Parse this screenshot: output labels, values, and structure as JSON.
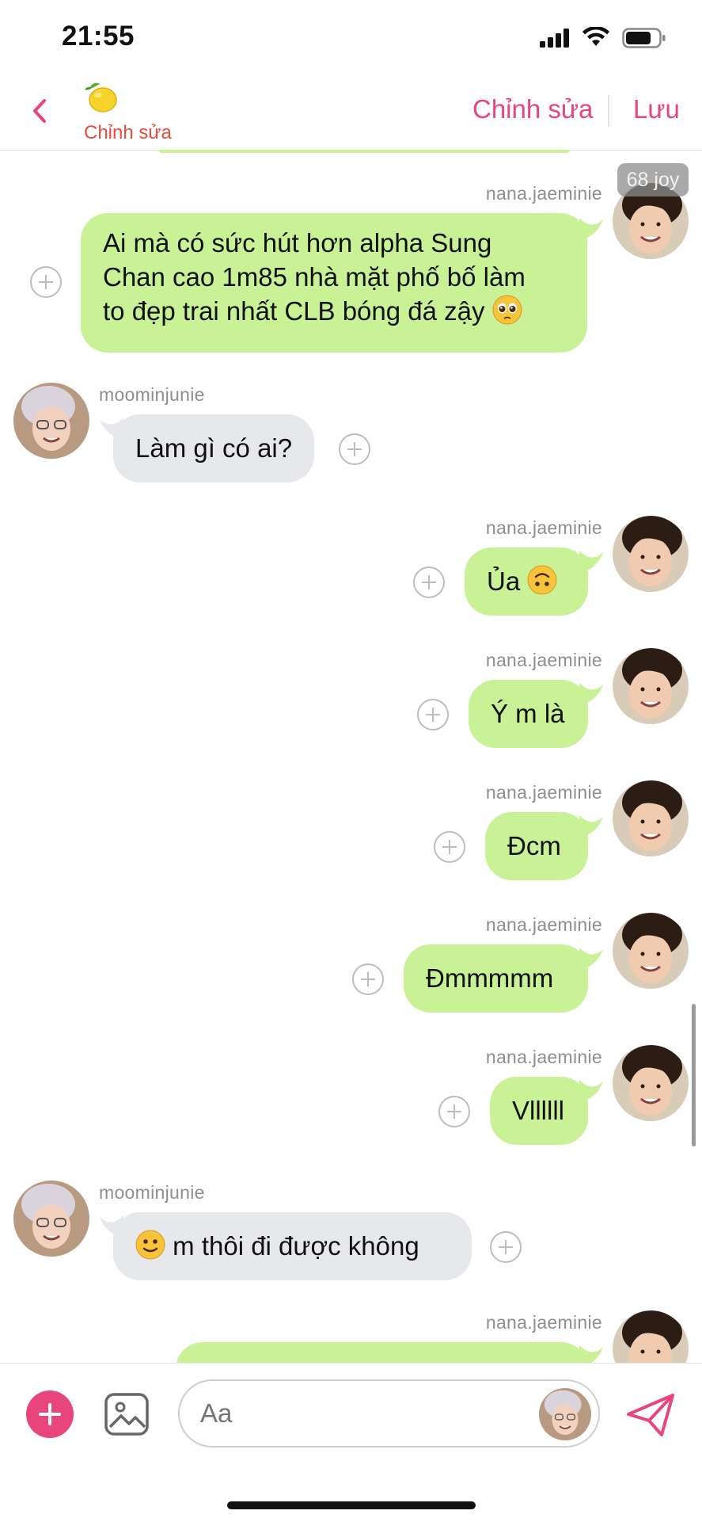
{
  "status": {
    "time": "21:55"
  },
  "nav": {
    "subtitle": "Chỉnh sửa",
    "edit_label": "Chỉnh sửa",
    "save_label": "Lưu"
  },
  "badge": "68 joy",
  "messages": [
    {
      "from": "me",
      "sender": "nana.jaeminie",
      "lines": [
        "Ai mà có sức hút hơn alpha Sung",
        "Chan cao 1m85 nhà mặt phố bố làm",
        "to đẹp trai nhất CLB bóng đá zậy"
      ],
      "emoji": "pleading-face"
    },
    {
      "from": "them",
      "sender": "moominjunie",
      "text": "Làm gì có ai?"
    },
    {
      "from": "me",
      "sender": "nana.jaeminie",
      "text": "Ủa",
      "emoji": "upside-down-face"
    },
    {
      "from": "me",
      "sender": "nana.jaeminie",
      "text": "Ý m là"
    },
    {
      "from": "me",
      "sender": "nana.jaeminie",
      "text": "Đcm"
    },
    {
      "from": "me",
      "sender": "nana.jaeminie",
      "text": "Đmmmmm"
    },
    {
      "from": "me",
      "sender": "nana.jaeminie",
      "text": "Vllllll"
    },
    {
      "from": "them",
      "sender": "moominjunie",
      "text": "m thôi đi được không",
      "emoji": "slightly-smiling-face"
    },
    {
      "from": "me",
      "sender": "nana.jaeminie",
      "text": ""
    }
  ],
  "input": {
    "placeholder": "Aa"
  },
  "icons": {
    "back": "chevron-left-icon",
    "lemon": "lemon-icon",
    "add": "plus-circle-icon",
    "image": "image-icon",
    "send": "send-icon",
    "reaction": "add-reaction-icon"
  },
  "colors": {
    "accent": "#e8457c",
    "my_bubble": "#c9f195",
    "their_bubble": "#e6e8eb",
    "nav_subtitle": "#ee4a3b"
  }
}
